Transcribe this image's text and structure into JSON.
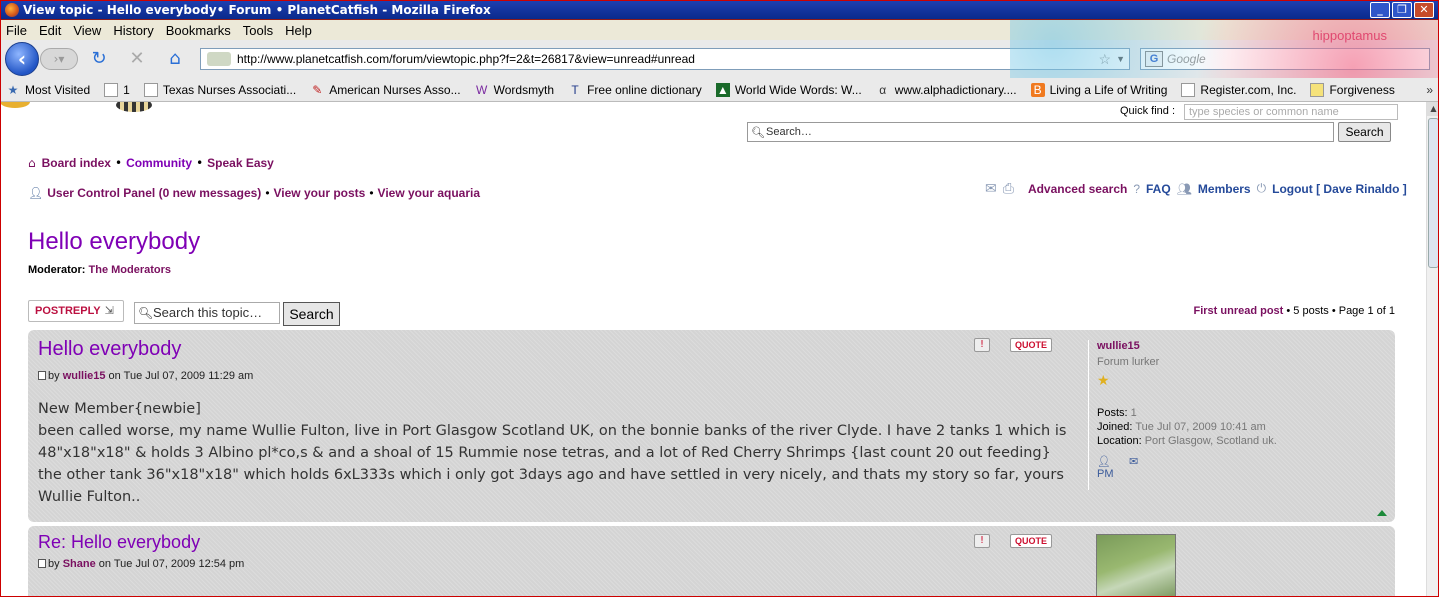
{
  "window": {
    "title": "View topic - Hello everybody• Forum • PlanetCatfish - Mozilla Firefox",
    "buttons": [
      "_",
      "❐",
      "✕"
    ]
  },
  "menu": [
    "File",
    "Edit",
    "View",
    "History",
    "Bookmarks",
    "Tools",
    "Help"
  ],
  "navbar": {
    "url": "http://www.planetcatfish.com/forum/viewtopic.php?f=2&t=26817&view=unread#unread",
    "search_engine_placeholder": "Google",
    "theme_text": "hippoptamus"
  },
  "bookmarks": [
    {
      "label": "Most Visited",
      "icon": "most-visited-icon"
    },
    {
      "label": "1",
      "icon": "page-icon"
    },
    {
      "label": "Texas Nurses Associati...",
      "icon": "page-icon"
    },
    {
      "label": "American Nurses Asso...",
      "icon": "bookmark-icon"
    },
    {
      "label": "Wordsmyth",
      "icon": "bookmark-icon"
    },
    {
      "label": "Free online dictionary",
      "icon": "bookmark-icon"
    },
    {
      "label": "World Wide Words: W...",
      "icon": "bookmark-icon"
    },
    {
      "label": "www.alphadictionary....",
      "icon": "bookmark-icon"
    },
    {
      "label": "Living a Life of Writing",
      "icon": "blogger-icon"
    },
    {
      "label": "Register.com, Inc.",
      "icon": "page-icon"
    },
    {
      "label": "Forgiveness",
      "icon": "page-icon"
    }
  ],
  "site": {
    "quickfind_label": "Quick find :",
    "quickfind_placeholder": "type species or common name",
    "search_placeholder": "Search…",
    "search_button": "Search"
  },
  "breadcrumb": {
    "board_index": "Board index",
    "community": "Community",
    "speak_easy": "Speak Easy",
    "sep": "•"
  },
  "user_row": {
    "ucp": "User Control Panel (0 new messages)",
    "view_posts": "View your posts",
    "view_aquaria": "View your aquaria",
    "sep": "•"
  },
  "tools": {
    "advanced_search": "Advanced search",
    "faq": "FAQ",
    "members": "Members",
    "logout": "Logout [ Dave Rinaldo ]"
  },
  "topic": {
    "title": "Hello everybody",
    "moderator_label": "Moderator:",
    "moderator_value": "The Moderators",
    "post_reply": "POSTREPLY",
    "search_placeholder": "Search this topic…",
    "search_button": "Search",
    "first_unread": "First unread post",
    "pagination": "• 5 posts • Page 1 of 1"
  },
  "posts": [
    {
      "title": "Hello everybody",
      "by": "by",
      "author": "wullie15",
      "date": "on Tue Jul 07, 2009 11:29 am",
      "content_line1": "New Member{newbie]",
      "content_rest": "been called worse, my name Wullie Fulton, live in Port Glasgow Scotland UK, on the bonnie banks of the river Clyde. I have 2 tanks 1 which is 48\"x18\"x18\" & holds 3 Albino pl*co,s & and a shoal of 15 Rummie nose tetras, and a lot of Red Cherry Shrimps {last count 20 out feeding} the other tank 36\"x18\"x18\" which holds 6xL333s which i only got 3days ago and have settled in very nicely, and thats my story so far, yours Wullie Fulton..",
      "quote": "QUOTE",
      "profile": {
        "username": "wullie15",
        "rank": "Forum lurker",
        "posts_label": "Posts:",
        "posts_value": "1",
        "joined_label": "Joined:",
        "joined_value": "Tue Jul 07, 2009 10:41 am",
        "location_label": "Location:",
        "location_value": "Port Glasgow, Scotland uk."
      }
    },
    {
      "title": "Re: Hello everybody",
      "by": "by",
      "author": "Shane",
      "date": "on Tue Jul 07, 2009 12:54 pm",
      "quote": "QUOTE"
    }
  ]
}
